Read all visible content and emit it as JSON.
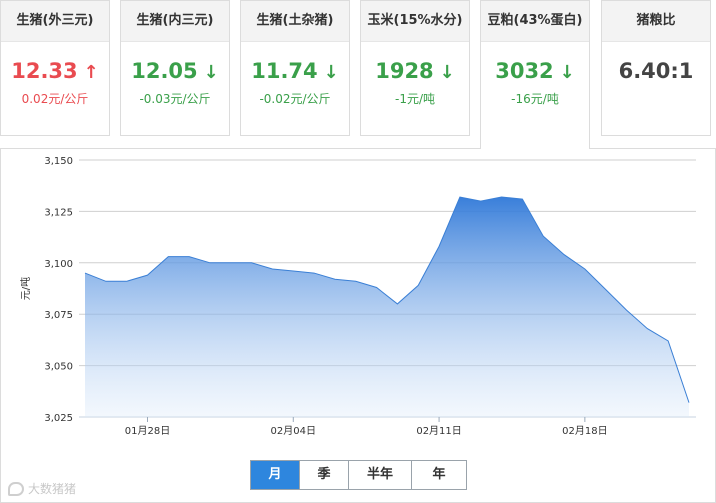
{
  "cards": [
    {
      "title": "生猪(外三元)",
      "price": "12.33",
      "arrow": "↑",
      "change": "0.02元/公斤",
      "trend": "up"
    },
    {
      "title": "生猪(内三元)",
      "price": "12.05",
      "arrow": "↓",
      "change": "-0.03元/公斤",
      "trend": "down"
    },
    {
      "title": "生猪(土杂猪)",
      "price": "11.74",
      "arrow": "↓",
      "change": "-0.02元/公斤",
      "trend": "down"
    },
    {
      "title": "玉米(15%水分)",
      "price": "1928",
      "arrow": "↓",
      "change": "-1元/吨",
      "trend": "down"
    },
    {
      "title": "豆粕(43%蛋白)",
      "price": "3032",
      "arrow": "↓",
      "change": "-16元/吨",
      "trend": "down"
    },
    {
      "title": "猪粮比",
      "price": "6.40:1",
      "arrow": "",
      "change": "",
      "trend": "neutral"
    }
  ],
  "colors": {
    "up": "#e94b50",
    "down": "#3aa04a",
    "accent": "#2e86de",
    "line": "#3a7fd5"
  },
  "tabs": [
    "月",
    "季",
    "半年",
    "年"
  ],
  "active_tab": 0,
  "active_card": 4,
  "watermark": "大数猪猪",
  "chart_data": {
    "type": "area",
    "ylabel": "元/吨",
    "ylim": [
      3025,
      3150
    ],
    "yticks": [
      3025,
      3050,
      3075,
      3100,
      3125,
      3150
    ],
    "ytick_labels": [
      "3,025",
      "3,050",
      "3,075",
      "3,100",
      "3,125",
      "3,150"
    ],
    "x_range": [
      0,
      29
    ],
    "xticks": [
      {
        "x": 3,
        "label": "01月28日"
      },
      {
        "x": 10,
        "label": "02月04日"
      },
      {
        "x": 17,
        "label": "02月11日"
      },
      {
        "x": 24,
        "label": "02月18日"
      }
    ],
    "grid": true,
    "values": [
      3095,
      3091,
      3091,
      3094,
      3103,
      3103,
      3100,
      3100,
      3100,
      3097,
      3096,
      3095,
      3092,
      3091,
      3088,
      3080,
      3089,
      3108,
      3132,
      3130,
      3132,
      3131,
      3113,
      3104,
      3097,
      3087,
      3077,
      3068,
      3062,
      3032
    ]
  }
}
